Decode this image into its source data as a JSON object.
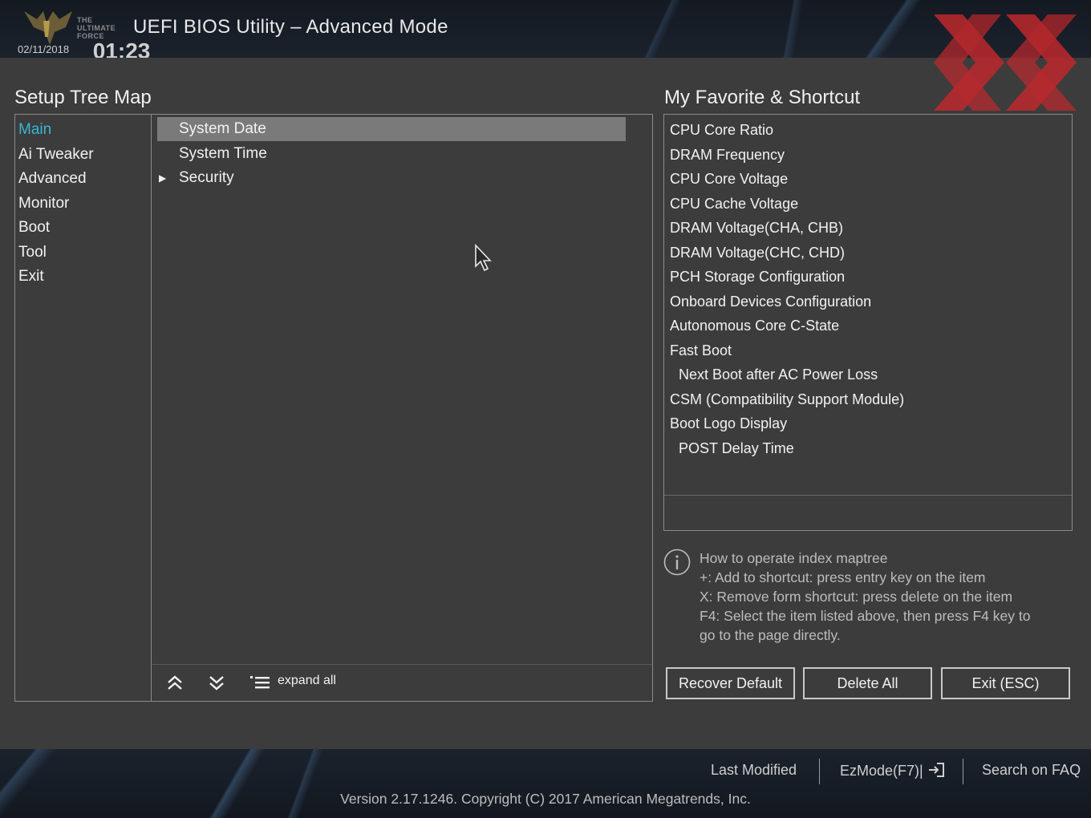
{
  "header": {
    "title": "UEFI BIOS Utility – Advanced Mode",
    "logo_text": [
      "THE",
      "ULTIMATE",
      "FORCE"
    ],
    "date": "02/11/2018",
    "time": "01:23"
  },
  "tree_map": {
    "title": "Setup Tree Map",
    "menu": [
      {
        "label": "Main",
        "active": true
      },
      {
        "label": "Ai Tweaker"
      },
      {
        "label": "Advanced"
      },
      {
        "label": "Monitor"
      },
      {
        "label": "Boot"
      },
      {
        "label": "Tool"
      },
      {
        "label": "Exit"
      }
    ],
    "items": [
      {
        "label": "System Date",
        "selected": true
      },
      {
        "label": "System Time"
      },
      {
        "label": "Security",
        "expandable": true
      }
    ],
    "toolbar": {
      "collapse_icon": "double-chevron-up-icon",
      "expand_icon": "double-chevron-down-icon",
      "expand_all_icon": "list-icon",
      "expand_all_label": "expand all"
    }
  },
  "favorites": {
    "title": "My Favorite & Shortcut",
    "items": [
      {
        "label": "CPU Core Ratio"
      },
      {
        "label": "DRAM Frequency"
      },
      {
        "label": "CPU Core Voltage"
      },
      {
        "label": "CPU Cache Voltage"
      },
      {
        "label": "DRAM Voltage(CHA, CHB)"
      },
      {
        "label": "DRAM Voltage(CHC, CHD)"
      },
      {
        "label": "PCH Storage Configuration"
      },
      {
        "label": "Onboard Devices Configuration"
      },
      {
        "label": "Autonomous Core C-State"
      },
      {
        "label": "Fast Boot"
      },
      {
        "label": "Next Boot after AC Power Loss",
        "sub": true
      },
      {
        "label": "CSM (Compatibility Support Module)"
      },
      {
        "label": "Boot Logo Display"
      },
      {
        "label": "POST Delay Time",
        "sub": true
      }
    ],
    "help": {
      "line1": "How to operate index maptree",
      "line2": "+: Add to shortcut: press entry key on the item",
      "line3": "X: Remove form shortcut: press delete on the item",
      "line4": "F4: Select the item listed above, then press F4 key to",
      "line5": "go to the page directly."
    },
    "buttons": {
      "recover": "Recover Default",
      "delete_all": "Delete All",
      "exit": "Exit (ESC)"
    }
  },
  "footer": {
    "last_modified": "Last Modified",
    "ezmode": "EzMode(F7)|",
    "search_faq": "Search on FAQ",
    "version": "Version 2.17.1246. Copyright (C) 2017 American Megatrends, Inc."
  },
  "colors": {
    "accent": "#38b7d4",
    "panel_bg": "#3c3c3c",
    "selected_row": "#7a7a7a",
    "watermark": "#c0282c"
  }
}
